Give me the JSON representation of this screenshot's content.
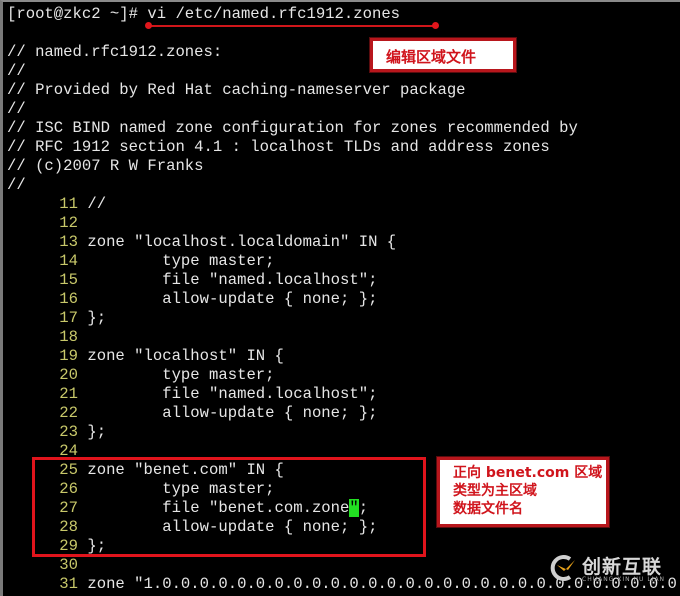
{
  "terminal": {
    "prompt": "[root@zkc2 ~]# ",
    "command": "vi /etc/named.rfc1912.zones",
    "header_lines": [
      "// named.rfc1912.zones:",
      "//",
      "// Provided by Red Hat caching-nameserver package",
      "//",
      "// ISC BIND named zone configuration for zones recommended by",
      "// RFC 1912 section 4.1 : localhost TLDs and address zones",
      "// (c)2007 R W Franks",
      "//"
    ],
    "numbered_lines": [
      {
        "n": "11",
        "text": "//"
      },
      {
        "n": "12",
        "text": ""
      },
      {
        "n": "13",
        "text": "zone \"localhost.localdomain\" IN {"
      },
      {
        "n": "14",
        "text": "        type master;"
      },
      {
        "n": "15",
        "text": "        file \"named.localhost\";"
      },
      {
        "n": "16",
        "text": "        allow-update { none; };"
      },
      {
        "n": "17",
        "text": "};"
      },
      {
        "n": "18",
        "text": ""
      },
      {
        "n": "19",
        "text": "zone \"localhost\" IN {"
      },
      {
        "n": "20",
        "text": "        type master;"
      },
      {
        "n": "21",
        "text": "        file \"named.localhost\";"
      },
      {
        "n": "22",
        "text": "        allow-update { none; };"
      },
      {
        "n": "23",
        "text": "};"
      },
      {
        "n": "24",
        "text": ""
      },
      {
        "n": "25",
        "text": "zone \"benet.com\" IN {"
      },
      {
        "n": "26",
        "text": "        type master;"
      },
      {
        "n": "27",
        "text_before_cursor": "        file \"benet.com.zone",
        "cursor_char": "\"",
        "text_after_cursor": ";"
      },
      {
        "n": "28",
        "text": "        allow-update { none; };"
      },
      {
        "n": "29",
        "text": "};"
      },
      {
        "n": "30",
        "text": ""
      },
      {
        "n": "31",
        "text": "zone \"1.0.0.0.0.0.0.0.0.0.0.0.0.0.0.0.0.0.0.0.0.0.0.0.0.0.0.0.0.0.0.0."
      }
    ]
  },
  "annotations": {
    "top_callout": "编辑区域文件",
    "side_callout": [
      "正向 benet.com 区域",
      "类型为主区域",
      "数据文件名"
    ]
  },
  "watermark": {
    "brand": "创新互联",
    "subtitle": "CHUANG XIN HU LIAN"
  },
  "colors": {
    "background": "#000000",
    "text": "#e6e6e6",
    "line_number": "#c8c86a",
    "cursor": "#22e022",
    "annotation_red": "#e0141c"
  }
}
